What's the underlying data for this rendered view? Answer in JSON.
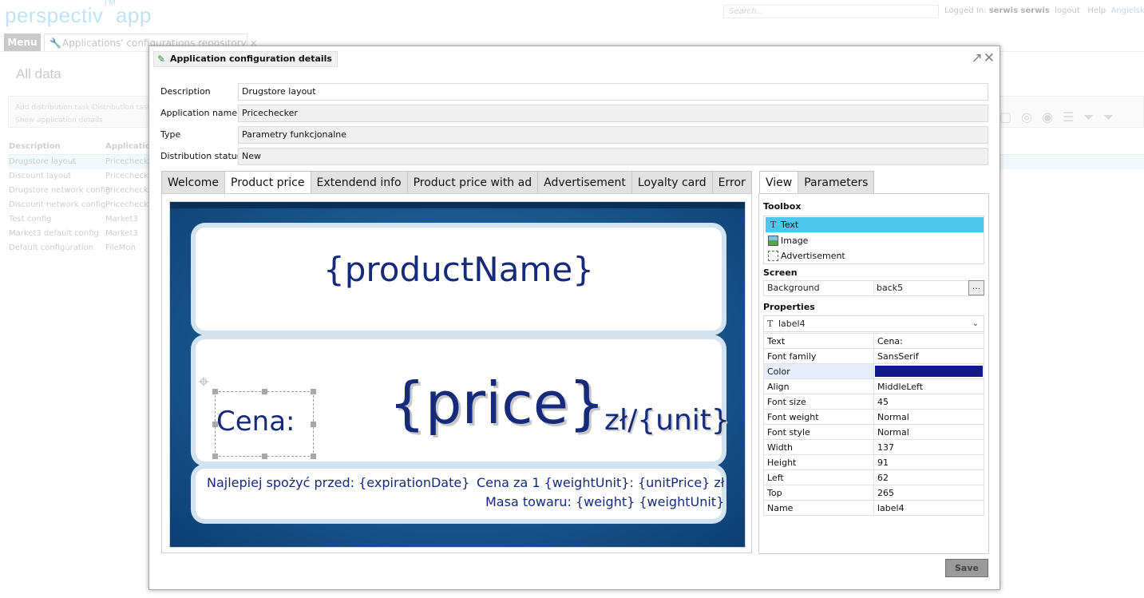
{
  "background": {
    "logo": "perspectiv",
    "logo_tm": "TM",
    "logo_suffix": "app",
    "search_placeholder": "Search...",
    "logged_in_label": "Logged In:",
    "user": "serwis serwis",
    "logout": "logout",
    "help": "Help",
    "language": "Angielski",
    "menu": "Menu",
    "app_tab": "Applications' configurations repository",
    "page_title": "All data",
    "toolbar_line1": "Add distribution task   Distribution task",
    "toolbar_line2": "Show application details",
    "col_description": "Description",
    "col_application": "Application",
    "rows": [
      {
        "description": "Drugstore layout",
        "application": "Pricechecker"
      },
      {
        "description": "Discount layout",
        "application": "Pricechecker"
      },
      {
        "description": "Drugstore network config",
        "application": "Pricechecker"
      },
      {
        "description": "Discount network config",
        "application": "Pricechecker"
      },
      {
        "description": "Test config",
        "application": "Market3"
      },
      {
        "description": "Market3 default config",
        "application": "Market3"
      },
      {
        "description": "Default configuration",
        "application": "FileMon"
      }
    ]
  },
  "dialog": {
    "title": "Application configuration details",
    "fields": [
      {
        "label": "Description",
        "value": "Drugstore layout"
      },
      {
        "label": "Application name",
        "value": "Pricechecker"
      },
      {
        "label": "Type",
        "value": "Parametry funkcjonalne"
      },
      {
        "label": "Distribution status",
        "value": "New"
      }
    ],
    "tabs": [
      "Welcome",
      "Product price",
      "Extendend info",
      "Product price with ad",
      "Advertisement",
      "Loyalty card",
      "Error"
    ],
    "active_tab": "Product price",
    "preview": {
      "product_name": "{productName}",
      "price": "{price}",
      "unit": "zł/{unit}",
      "price_label": "Cena:",
      "expiration": "Najlepiej spożyć przed: {expirationDate}",
      "unit_price": "Cena za 1 {weightUnit}: {unitPrice} zł",
      "weight": "Masa towaru: {weight} {weightUnit}"
    },
    "right_tabs": [
      "View",
      "Parameters"
    ],
    "active_right_tab": "View",
    "toolbox_title": "Toolbox",
    "toolbox_items": [
      {
        "label": "Text",
        "icon": "text-tool-icon",
        "selected": true
      },
      {
        "label": "Image",
        "icon": "image-tool-icon",
        "selected": false
      },
      {
        "label": "Advertisement",
        "icon": "advertisement-tool-icon",
        "selected": false
      }
    ],
    "screen_title": "Screen",
    "background_label": "Background",
    "background_value": "back5",
    "browse_label": "...",
    "properties_title": "Properties",
    "selected_element": "label4",
    "properties": [
      {
        "key": "Text",
        "value": "Cena:"
      },
      {
        "key": "Font family",
        "value": "SansSerif"
      },
      {
        "key": "Color",
        "value": "",
        "color": "#121a8a"
      },
      {
        "key": "Align",
        "value": "MiddleLeft"
      },
      {
        "key": "Font size",
        "value": "45"
      },
      {
        "key": "Font weight",
        "value": "Normal"
      },
      {
        "key": "Font style",
        "value": "Normal"
      },
      {
        "key": "Width",
        "value": "137"
      },
      {
        "key": "Height",
        "value": "91"
      },
      {
        "key": "Left",
        "value": "62"
      },
      {
        "key": "Top",
        "value": "265"
      },
      {
        "key": "Name",
        "value": "label4"
      }
    ],
    "save_label": "Save"
  },
  "colors": {
    "accent": "#4fc6eb",
    "text_dark_blue": "#152a7a",
    "label_color": "#121a8a"
  }
}
